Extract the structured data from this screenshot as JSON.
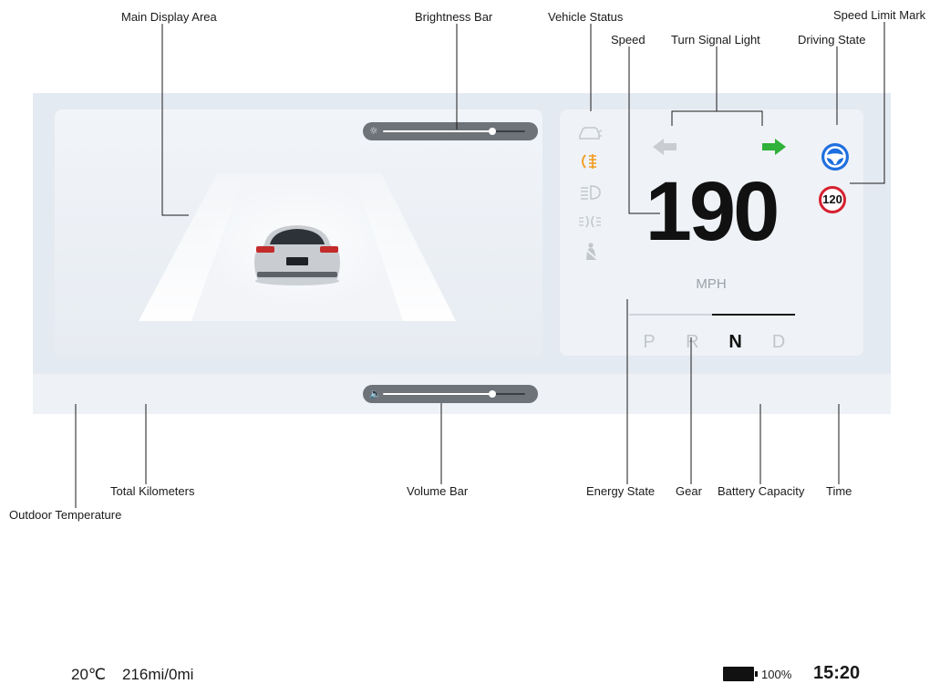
{
  "callouts": {
    "main_display_area": "Main Display Area",
    "brightness_bar": "Brightness Bar",
    "vehicle_status": "Vehicle Status",
    "speed": "Speed",
    "turn_signal_light": "Turn Signal Light",
    "driving_state": "Driving State",
    "speed_limit_mark": "Speed Limit Mark",
    "outdoor_temperature": "Outdoor Temperature",
    "total_kilometers": "Total Kilometers",
    "volume_bar": "Volume Bar",
    "energy_state": "Energy State",
    "gear": "Gear",
    "battery_capacity": "Battery Capacity",
    "time": "Time"
  },
  "dashboard": {
    "brightness": {
      "icon": "sun-icon",
      "level": 0.77
    },
    "volume": {
      "icon": "speaker-icon",
      "level": 0.77
    },
    "vehicle_status_icons": [
      {
        "icon": "car-door-icon",
        "color": "#c2c7cc"
      },
      {
        "icon": "fog-light-icon",
        "color": "#f39a1c"
      },
      {
        "icon": "low-beam-icon",
        "color": "#c2c7cc"
      },
      {
        "icon": "parking-light-icon",
        "color": "#c2c7cc"
      },
      {
        "icon": "seatbelt-icon",
        "color": "#c2c7cc"
      }
    ],
    "turn_signal": {
      "left": {
        "icon": "arrow-left-icon",
        "active": false,
        "color": "#c9cdd2"
      },
      "right": {
        "icon": "arrow-right-icon",
        "active": true,
        "color": "#2fb13a"
      }
    },
    "driving_state": {
      "icon": "steering-wheel-icon",
      "color": "#1f6fe0"
    },
    "speed_limit": "120",
    "speed": "190",
    "speed_unit": "MPH",
    "energy_level": 0.5,
    "gears": [
      "P",
      "R",
      "N",
      "D"
    ],
    "active_gear": "N",
    "outdoor_temperature": "20℃",
    "total_distance": "216mi/0mi",
    "battery": {
      "icon": "battery-icon",
      "percent": "100%"
    },
    "time": "15:20"
  }
}
